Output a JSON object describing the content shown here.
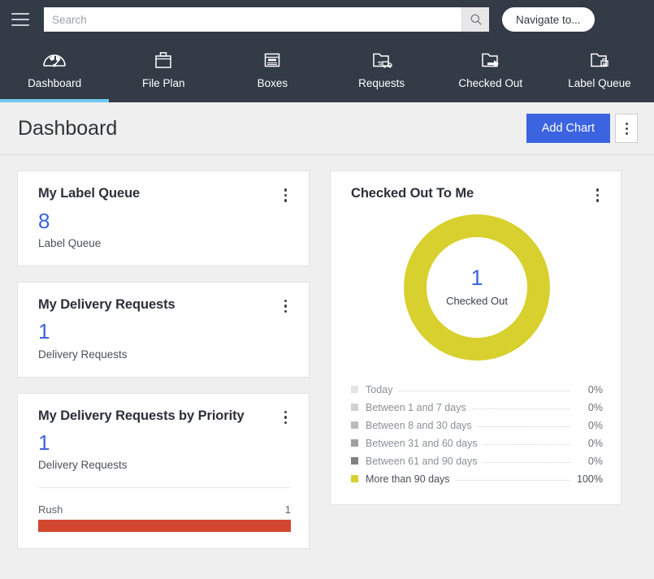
{
  "topbar": {
    "menu_icon": "hamburger-icon",
    "search": {
      "placeholder": "Search",
      "value": "",
      "button_icon": "search-icon"
    },
    "navigate_label": "Navigate to..."
  },
  "nav": {
    "tabs": [
      {
        "label": "Dashboard",
        "icon": "gauge-icon",
        "active": true
      },
      {
        "label": "File Plan",
        "icon": "briefcase-icon",
        "active": false
      },
      {
        "label": "Boxes",
        "icon": "archive-box-icon",
        "active": false
      },
      {
        "label": "Requests",
        "icon": "folder-truck-icon",
        "active": false
      },
      {
        "label": "Checked Out",
        "icon": "folder-arrow-icon",
        "active": false
      },
      {
        "label": "Label Queue",
        "icon": "folder-printer-icon",
        "active": false
      }
    ],
    "active_indicator_color": "#6ec6f0"
  },
  "page": {
    "title": "Dashboard",
    "add_chart_label": "Add Chart",
    "add_chart_color": "#3c64e0",
    "kebab_icon": "kebab-menu-icon"
  },
  "cards": {
    "label_queue": {
      "title": "My Label Queue",
      "value": "8",
      "value_label": "Label Queue",
      "kebab_icon": "kebab-menu-icon"
    },
    "delivery_requests": {
      "title": "My Delivery Requests",
      "value": "1",
      "value_label": "Delivery Requests",
      "kebab_icon": "kebab-menu-icon"
    },
    "delivery_by_priority": {
      "title": "My Delivery Requests by Priority",
      "value": "1",
      "value_label": "Delivery Requests",
      "kebab_icon": "kebab-menu-icon",
      "chart_data": {
        "type": "bar",
        "orientation": "horizontal",
        "categories": [
          "Rush"
        ],
        "values": [
          1
        ],
        "value_labels": [
          "1"
        ],
        "colors": [
          "#d1472f"
        ],
        "max": 1,
        "title": "My Delivery Requests by Priority",
        "xlabel": "",
        "ylabel": ""
      }
    },
    "checked_out": {
      "title": "Checked Out To Me",
      "kebab_icon": "kebab-menu-icon",
      "center_value": "1",
      "center_label": "Checked Out",
      "chart_data": {
        "type": "pie",
        "variant": "donut",
        "title": "Checked Out To Me",
        "center_value": "1",
        "center_label": "Checked Out",
        "legend_position": "bottom",
        "labels": [
          "Today",
          "Between 1 and 7 days",
          "Between 8 and 30 days",
          "Between 31 and 60 days",
          "Between 61 and 90 days",
          "More than 90 days"
        ],
        "values": [
          0,
          0,
          0,
          0,
          0,
          100
        ],
        "value_labels": [
          "0%",
          "0%",
          "0%",
          "0%",
          "0%",
          "100%"
        ],
        "colors": [
          "#e4e4e4",
          "#d2d2d2",
          "#bbbbbb",
          "#a0a0a0",
          "#808080",
          "#d8d02e"
        ]
      }
    }
  }
}
